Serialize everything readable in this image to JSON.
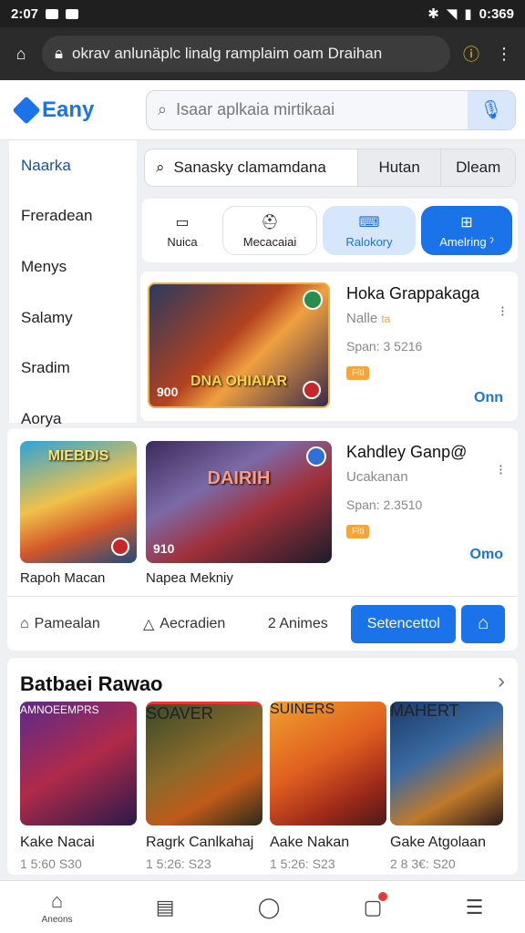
{
  "statusbar": {
    "time": "2:07",
    "battery": "0:369"
  },
  "browser": {
    "url": "okrav anlunäplc linalg ramplaim oam Draihan"
  },
  "header": {
    "logo": "Eany",
    "search_placeholder": "Isaar aplkaia mirtikaai"
  },
  "sidebar": {
    "items": [
      {
        "label": "Naarka"
      },
      {
        "label": "Freradean"
      },
      {
        "label": "Menys"
      },
      {
        "label": "Salamy"
      },
      {
        "label": "Sradim"
      },
      {
        "label": "Aorya"
      }
    ]
  },
  "filterbar": {
    "query": "Sanasky clamamdana",
    "seg1": "Hutan",
    "seg2": "Dleam"
  },
  "chips": [
    {
      "label": "Nuica",
      "icon": "▭"
    },
    {
      "label": "Mecacaiai",
      "icon": "⛑"
    },
    {
      "label": "Ralokory",
      "icon": "⌨"
    },
    {
      "label": "Amelring ˀ",
      "icon": "⊞"
    }
  ],
  "featured1": {
    "art_text": "DNA OHIAIAR",
    "price_tag": "900",
    "name": "Hoka Grappakaga",
    "sub": "Nalle",
    "sub_icon": "ta",
    "meta": "Span: 3 5216",
    "mini": "Fiti",
    "action": "Onn",
    "more": "⁝"
  },
  "featured2": {
    "thumb1_art": "MIEBDIS",
    "thumb1_label": "Rapoh Macan",
    "thumb2_art": "DAIRIH",
    "thumb2_price": "910",
    "thumb2_label": "Napea Mekniy",
    "name": "Kahdley Ganp@",
    "sub": "Ucakanan",
    "meta": "Span: 2.3510",
    "mini": "Fiti",
    "action": "Omo",
    "more": "⁝"
  },
  "actionbar": {
    "a1": "Pamealan",
    "a2": "Aecradien",
    "a3": "2 Animes",
    "primary": "Setencettol",
    "icon_btn": "⌂"
  },
  "section": {
    "title": "Batbaei Rawao",
    "chevron": "›"
  },
  "shelf": [
    {
      "art": "AMNOEEMPRS",
      "name": "Kake Nacai",
      "price": "1 5:60  S30"
    },
    {
      "art": "SOAVER",
      "name": "Ragrk Canlkahaj",
      "price": "1 5:26: S23"
    },
    {
      "art": "SUINERS",
      "name": "Aake Nakan",
      "price": "1 5:26: S23"
    },
    {
      "art": "MAHERT",
      "name": "Gake Atgolaan",
      "price": "2 8 3€: S20"
    }
  ],
  "bottomnav": {
    "home_label": "Aneons"
  },
  "colors": {
    "accent": "#1a73e8",
    "status_bar": "#1f1f1f",
    "browser_bar": "#2b2b2b"
  }
}
